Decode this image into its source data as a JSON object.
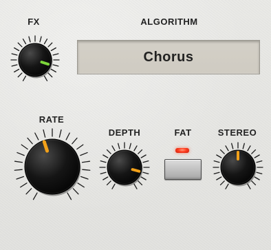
{
  "labels": {
    "fx": "FX",
    "algorithm": "ALGORITHM",
    "rate": "RATE",
    "depth": "DEPTH",
    "fat": "FAT",
    "stereo": "STEREO"
  },
  "algorithm": {
    "value": "Chorus"
  },
  "knobs": {
    "fx": {
      "indicator_color": "#7cd63a",
      "value": 0.86
    },
    "rate": {
      "indicator_color": "#f2a11a",
      "value": 0.44
    },
    "depth": {
      "indicator_color": "#f2a11a",
      "value": 0.85
    },
    "stereo": {
      "indicator_color": "#f2a11a",
      "value": 0.5
    }
  },
  "fat": {
    "led_on": true,
    "led_color": "#ff3b1d"
  },
  "icons": {
    "knob": "rotary-knob-icon",
    "led": "led-indicator-icon",
    "button": "push-button-icon"
  }
}
